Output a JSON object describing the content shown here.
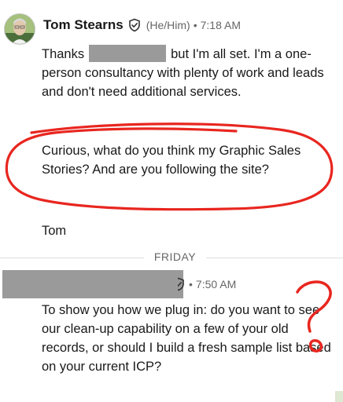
{
  "message1": {
    "sender": "Tom Stearns",
    "pronouns": "(He/Him)",
    "separator": "•",
    "time": "7:18 AM",
    "para1_before": "Thanks",
    "para1_after": "but I'm all set. I'm a one-person consultancy with plenty of work and leads and don't need additional services.",
    "para2": "Curious, what do you think my Graphic Sales Stories? And are you following the site?",
    "signature": "Tom"
  },
  "divider": {
    "label": "FRIDAY"
  },
  "message2": {
    "separator": "•",
    "time": "7:50 AM",
    "body": "To show you how we plug in: do you want to see our clean-up capability on a few of your old records, or should I build a fresh sample list based on your current ICP?"
  },
  "annotation_color": "#e8261f",
  "redaction_color": "#9a9a9a"
}
